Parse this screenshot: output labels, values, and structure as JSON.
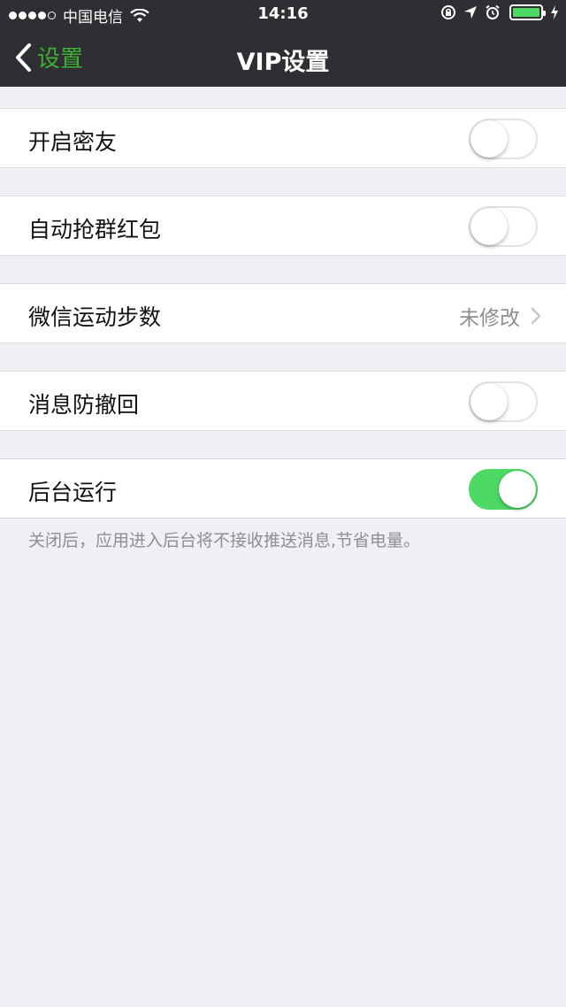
{
  "status_bar": {
    "carrier": "中国电信",
    "time": "14:16",
    "icons": [
      "signal-dots",
      "wifi-icon",
      "rotation-lock-icon",
      "location-arrow-icon",
      "alarm-icon",
      "battery-icon",
      "charging-bolt-icon"
    ],
    "battery_color": "#4cd964"
  },
  "navbar": {
    "back_label": "设置",
    "title": "VIP设置",
    "accent_color": "#3cb034"
  },
  "settings": [
    {
      "label": "开启密友",
      "type": "toggle",
      "on": false
    },
    {
      "label": "自动抢群红包",
      "type": "toggle",
      "on": false
    },
    {
      "label": "微信运动步数",
      "type": "detail",
      "value": "未修改"
    },
    {
      "label": "消息防撤回",
      "type": "toggle",
      "on": false
    },
    {
      "label": "后台运行",
      "type": "toggle",
      "on": true
    }
  ],
  "footer_note": "关闭后，应用进入后台将不接收推送消息,节省电量。",
  "colors": {
    "toggle_on": "#4cd964",
    "background": "#efeff4"
  }
}
